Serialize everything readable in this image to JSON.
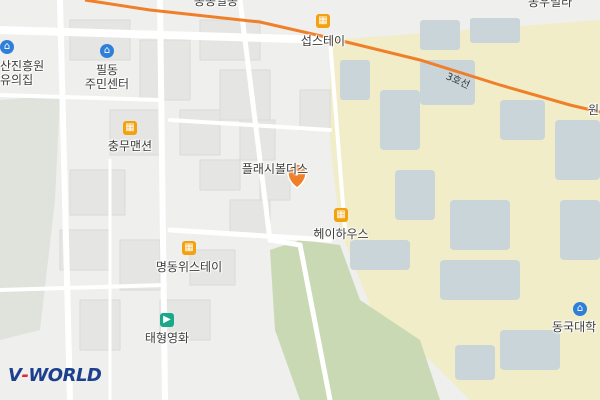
{
  "colors": {
    "background": "#efefed",
    "road": "#ffffff",
    "campus": "#f1edc8",
    "building": "#c9d5d9",
    "park": "#c9d9b4",
    "route": "#f07f2a",
    "marker": "#f07f2a",
    "logo_primary": "#1c3f8e",
    "logo_accent": "#e8262f"
  },
  "labels": {
    "top_partial": "동동일동",
    "top_right_partial": "동우빌라",
    "seobstay": "섭스테이",
    "sanjin": "산진흥원",
    "sanjin_sub": "유의집",
    "pildong": "필동",
    "pildong_sub": "주민센터",
    "chungmu": "충무맨션",
    "place_bulders": "플래시볼더스",
    "heyhouse": "헤이하우스",
    "myeongdong_wistay": "명동위스테이",
    "taehyung_cinema": "태형영화",
    "dongguk": "동국대학",
    "right_partial": "원"
  },
  "route": {
    "name": "3호선"
  },
  "icons": {
    "building": "building-icon",
    "office": "house-icon",
    "cinema": "camera-icon",
    "marker": "location-pin-icon"
  },
  "logo": {
    "prefix": "V",
    "dash": "-",
    "text": "WORLD"
  }
}
